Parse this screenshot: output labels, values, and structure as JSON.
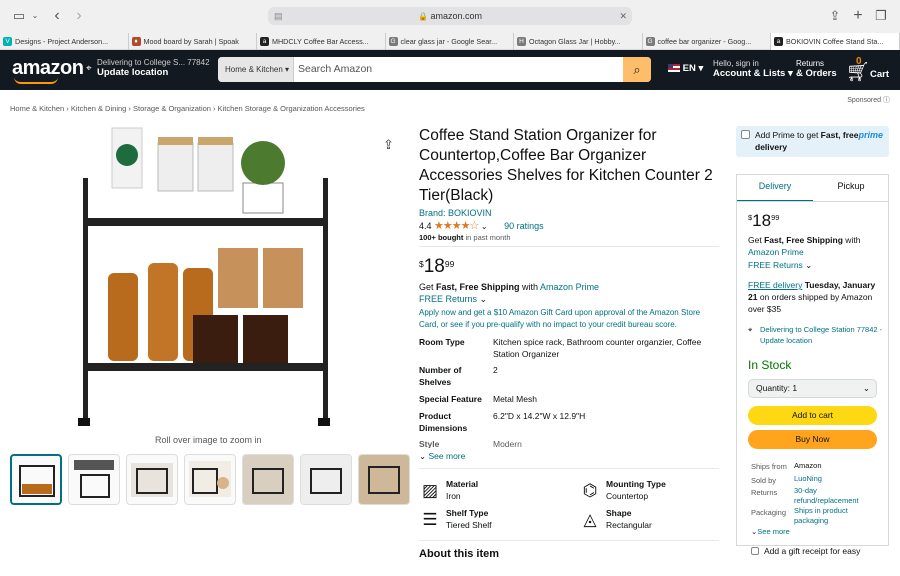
{
  "browser": {
    "url": "amazon.com",
    "tabs": [
      {
        "title": "Designs - Project Anderson...",
        "icon": "V",
        "color": "#00b3b3"
      },
      {
        "title": "Mood board by Sarah | Spoak",
        "icon": "♦",
        "color": "#b04a2e"
      },
      {
        "title": "MHDCLY Coffee Bar Access...",
        "icon": "a",
        "color": "#222"
      },
      {
        "title": "clear glass jar - Google Sear...",
        "icon": "G",
        "color": "#7a7a7a"
      },
      {
        "title": "Octagon Glass Jar | Hobby...",
        "icon": "H",
        "color": "#7a7a7a"
      },
      {
        "title": "coffee bar organizer - Goog...",
        "icon": "G",
        "color": "#7a7a7a"
      },
      {
        "title": "BOKIOVIN Coffee Stand Sta...",
        "icon": "a",
        "color": "#222"
      }
    ]
  },
  "nav": {
    "logo": "amazon",
    "deliver_line1": "Delivering to College S... 77842",
    "deliver_line2": "Update location",
    "search_category": "Home & Kitchen",
    "search_placeholder": "Search Amazon",
    "lang": "EN",
    "account_line1": "Hello, sign in",
    "account_line2": "Account & Lists",
    "returns_line1": "Returns",
    "returns_line2": "& Orders",
    "cart_count": "0",
    "cart_label": "Cart"
  },
  "breadcrumb": [
    "Home & Kitchen",
    "Kitchen & Dining",
    "Storage & Organization",
    "Kitchen Storage & Organization Accessories"
  ],
  "sponsored": "Sponsored",
  "gallery": {
    "roll_text": "Roll over image to zoom in"
  },
  "product": {
    "title": "Coffee Stand Station Organizer for Countertop,Coffee Bar Organizer Accessories Shelves for Kitchen Counter 2 Tier(Black)",
    "brand": "Brand: BOKIOVIN",
    "rating": "4.4",
    "stars": "★★★★☆",
    "ratings_count": "90 ratings",
    "bought_bold": "100+ bought",
    "bought_rest": " in past month",
    "price_symbol": "$",
    "price_whole": "18",
    "price_fraction": "99",
    "ship_prefix": "Get ",
    "ship_bold": "Fast, Free Shipping",
    "ship_mid": " with ",
    "ship_link": "Amazon Prime",
    "free_returns": "FREE Returns",
    "apply_text": "Apply now and get a $10 Amazon Gift Card upon approval of the Amazon Store Card, or see if you pre-qualify with no impact to your credit bureau score.",
    "specs": [
      {
        "k": "Room Type",
        "v": "Kitchen spice rack, Bathroom counter organzier, Coffee Station Organizer"
      },
      {
        "k": "Number of Shelves",
        "v": "2"
      },
      {
        "k": "Special Feature",
        "v": "Metal Mesh"
      },
      {
        "k": "Product Dimensions",
        "v": "6.2\"D x 14.2\"W x 12.9\"H"
      },
      {
        "k": "Style",
        "v": "Modern"
      }
    ],
    "see_more": "See more",
    "attrs": [
      {
        "t": "Material",
        "v": "Iron",
        "icon": "material-icon"
      },
      {
        "t": "Mounting Type",
        "v": "Countertop",
        "icon": "mounting-icon"
      },
      {
        "t": "Shelf Type",
        "v": "Tiered Shelf",
        "icon": "shelf-icon"
      },
      {
        "t": "Shape",
        "v": "Rectangular",
        "icon": "shape-icon"
      }
    ],
    "about": "About this item"
  },
  "buybox": {
    "prime_text_pre": "Add Prime to get ",
    "prime_text_bold": "Fast, free delivery",
    "prime_logo": "prime",
    "tab_delivery": "Delivery",
    "tab_pickup": "Pickup",
    "price_whole": "18",
    "price_fraction": "99",
    "price_symbol": "$",
    "ship_prefix": "Get ",
    "ship_bold": "Fast, Free Shipping",
    "ship_mid": " with ",
    "ship_link": "Amazon Prime",
    "free_returns": "FREE Returns",
    "free_delivery_link": "FREE delivery",
    "delivery_date": "Tuesday, January 21",
    "delivery_rest": " on orders shipped by Amazon over $35",
    "deliver_to": "Delivering to College Station 77842 - Update location",
    "stock": "In Stock",
    "qty_label": "Quantity:",
    "qty_value": "1",
    "add_to_cart": "Add to cart",
    "buy_now": "Buy Now",
    "ships_from_k": "Ships from",
    "ships_from_v": "Amazon",
    "sold_by_k": "Sold by",
    "sold_by_v": "LuoNing",
    "returns_k": "Returns",
    "returns_v": "30-day refund/replacement",
    "packaging_k": "Packaging",
    "packaging_v": "Ships in product packaging",
    "see_more": "See more",
    "gift": "Add a gift receipt for easy"
  }
}
